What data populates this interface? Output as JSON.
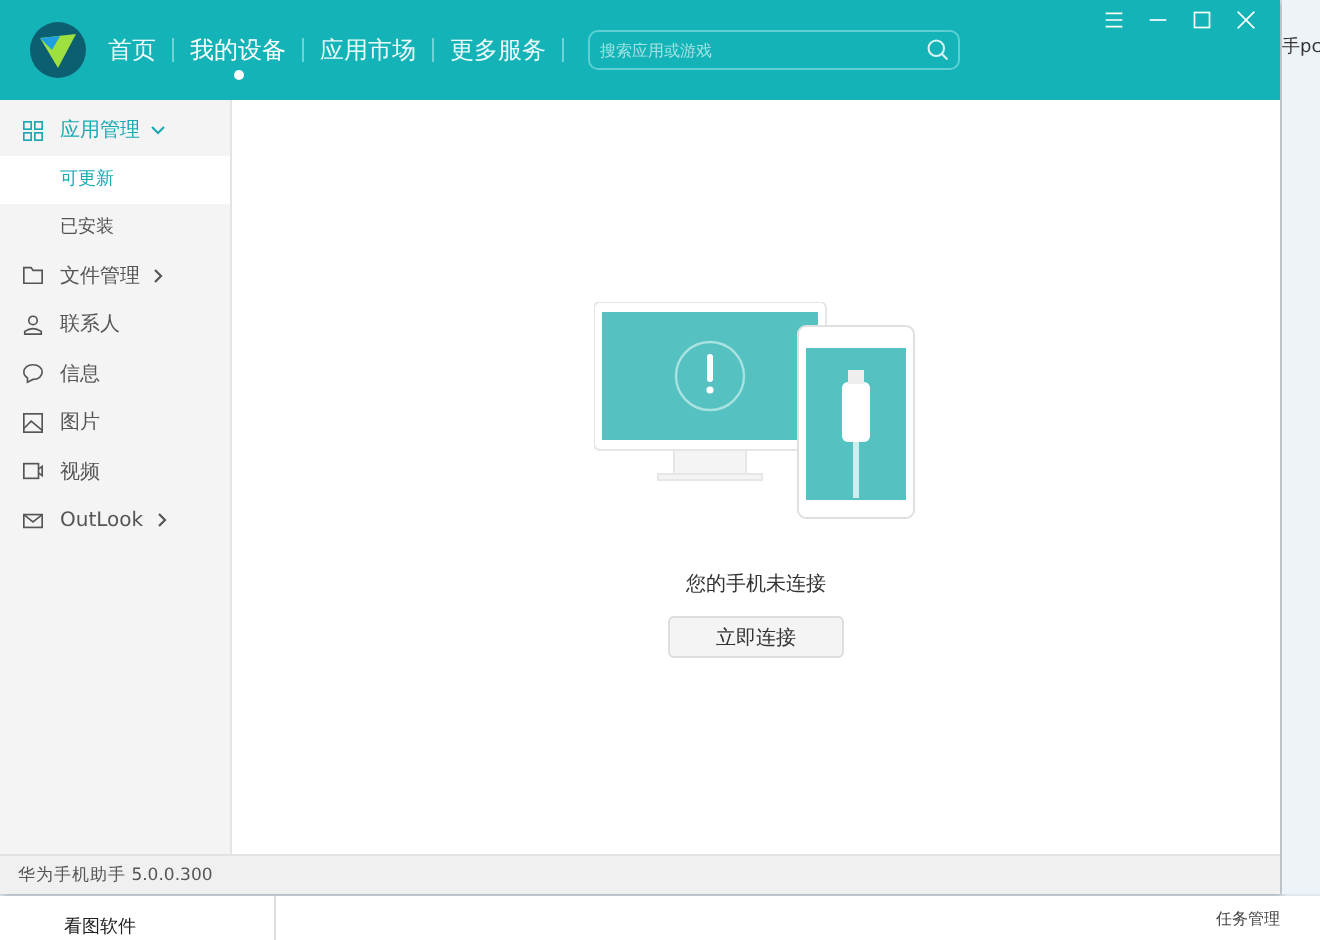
{
  "header": {
    "nav": [
      {
        "label": "首页",
        "selected": false
      },
      {
        "label": "我的设备",
        "selected": true
      },
      {
        "label": "应用市场",
        "selected": false
      },
      {
        "label": "更多服务",
        "selected": false
      }
    ],
    "search": {
      "placeholder": "搜索应用或游戏"
    }
  },
  "sidebar": {
    "items": [
      {
        "kind": "group",
        "label": "应用管理",
        "expanded": true,
        "children": [
          {
            "label": "可更新",
            "selected": true
          },
          {
            "label": "已安装",
            "selected": false
          }
        ]
      },
      {
        "kind": "group",
        "label": "文件管理",
        "expanded": false
      },
      {
        "kind": "item",
        "label": "联系人"
      },
      {
        "kind": "item",
        "label": "信息"
      },
      {
        "kind": "item",
        "label": "图片"
      },
      {
        "kind": "item",
        "label": "视频"
      },
      {
        "kind": "group",
        "label": "OutLook",
        "expanded": false
      }
    ]
  },
  "main": {
    "message": "您的手机未连接",
    "button": "立即连接"
  },
  "status_bar": {
    "version": "华为手机助手 5.0.0.300"
  },
  "background": {
    "right_text": "手pc",
    "bottom_items": [
      "看图软件"
    ],
    "taskbar_text": "任务管理"
  }
}
